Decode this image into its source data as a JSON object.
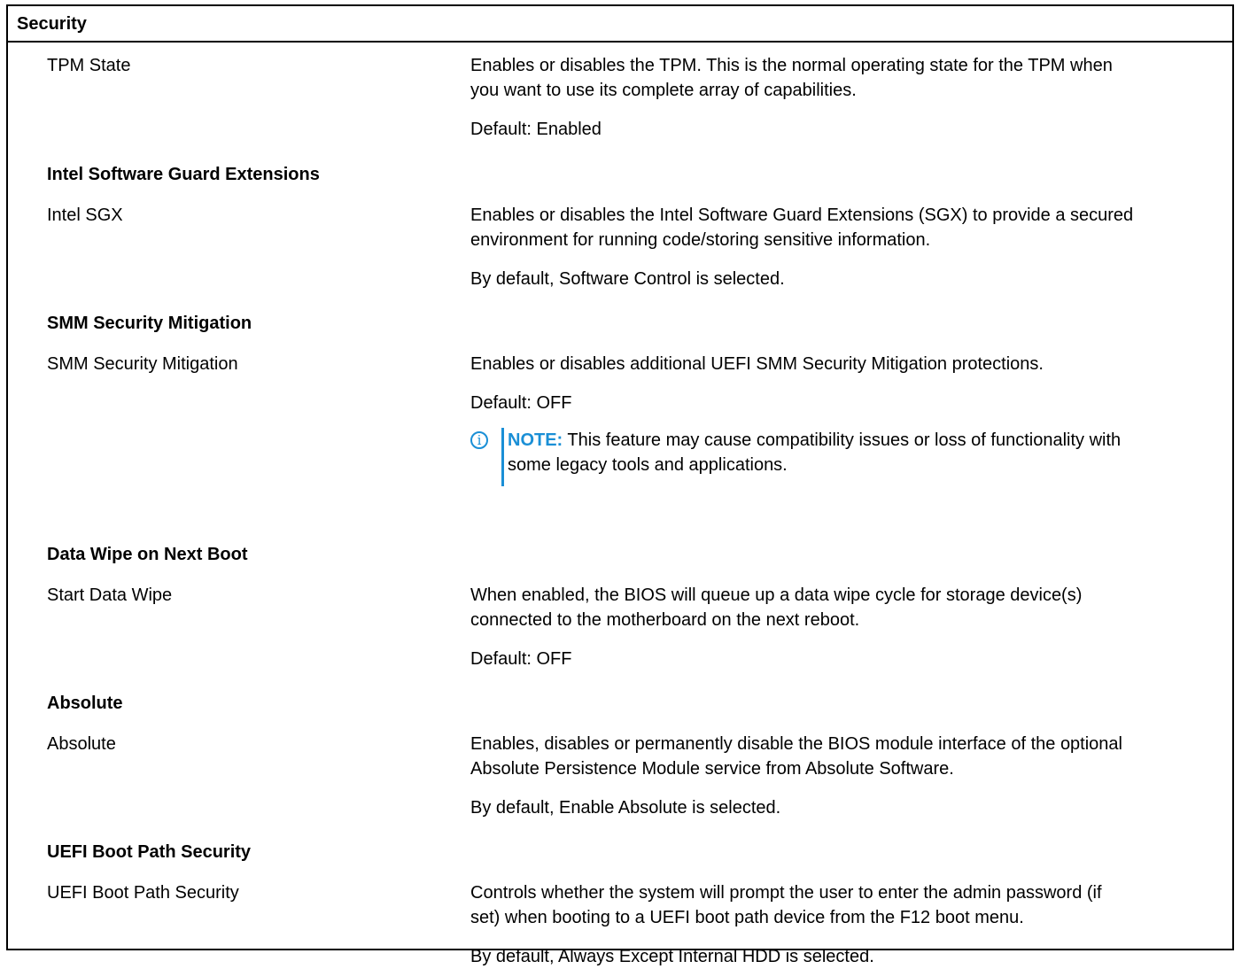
{
  "table_title": "Security",
  "colors": {
    "note_accent": "#1a8fd6",
    "border": "#000000"
  },
  "sections": {
    "tpm": {
      "name": "TPM State",
      "desc_line1": "Enables or disables the TPM. This is the normal operating state for the TPM when",
      "desc_line2": "you want to use its complete array of capabilities.",
      "default": "Default: Enabled"
    },
    "sgx": {
      "heading": "Intel Software Guard Extensions",
      "name": "Intel SGX",
      "desc_line1": "Enables or disables the Intel Software Guard Extensions (SGX) to provide a secured",
      "desc_line2": "environment for running code/storing sensitive information.",
      "default": "By default, Software Control is selected."
    },
    "smm": {
      "heading": "SMM Security Mitigation",
      "name": "SMM Security Mitigation",
      "desc_line1": "Enables or disables additional UEFI SMM Security Mitigation protections.",
      "default": "Default: OFF",
      "note_icon": "info-circle-icon",
      "note_label": "NOTE:",
      "note_line1": "This feature may cause compatibility issues or loss of functionality with",
      "note_line2": "some legacy tools and applications."
    },
    "wipe": {
      "heading": "Data Wipe on Next Boot",
      "name": "Start Data Wipe",
      "desc_line1": "When enabled, the BIOS will queue up a data wipe cycle for storage device(s)",
      "desc_line2": "connected to the motherboard on the next reboot.",
      "default": "Default: OFF"
    },
    "absolute": {
      "heading": "Absolute",
      "name": "Absolute",
      "desc_line1": "Enables, disables or permanently disable the BIOS module interface of the optional",
      "desc_line2": "Absolute Persistence Module service from Absolute Software.",
      "default": "By default, Enable Absolute is selected."
    },
    "uefi": {
      "heading": "UEFI Boot Path Security",
      "name": "UEFI Boot Path Security",
      "desc_line1": "Controls whether the system will prompt the user to enter the admin password (if",
      "desc_line2": "set) when booting to a UEFI boot path device from the F12 boot menu.",
      "default": "By default, Always Except Internal HDD is selected."
    }
  }
}
